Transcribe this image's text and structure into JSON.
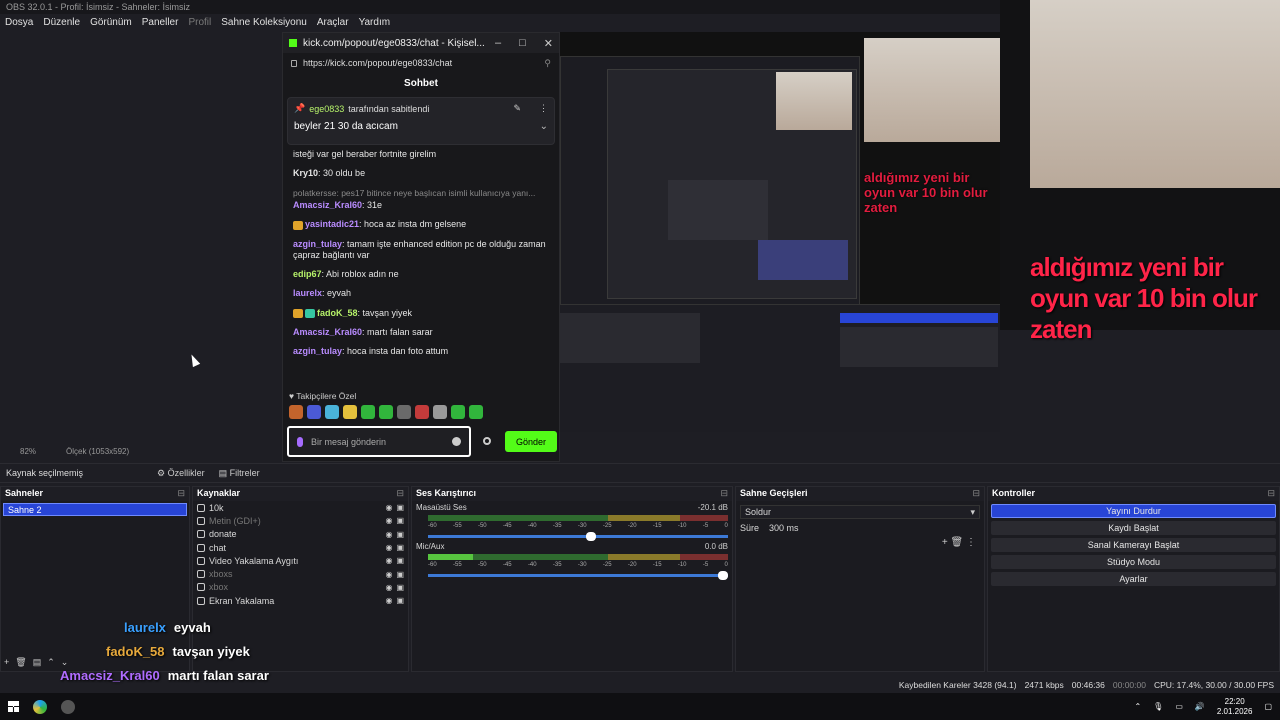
{
  "obs": {
    "title": "OBS 32.0.1 - Profil: İsimsiz - Sahneler: İsimsiz",
    "menu": [
      "Dosya",
      "Düzenle",
      "Görünüm",
      "Paneller",
      "Profil",
      "Sahne Koleksiyonu",
      "Araçlar",
      "Yardım"
    ],
    "zoom": "82%",
    "scale_info": "Ölçek (1053x592)",
    "no_source": "Kaynak seçilmemiş",
    "properties": "Özellikler",
    "filters": "Filtreler"
  },
  "kick": {
    "window_title": "kick.com/popout/ege0833/chat - Kişisel...",
    "url": "https://kick.com/popout/ege0833/chat",
    "chat_title": "Sohbet",
    "pinned_user": "ege0833",
    "pinned_by": "tarafından sabitlendi",
    "pinned_text": "beyler 21 30 da acıcam",
    "messages": [
      {
        "user": "",
        "text": "isteği var gel beraber fortnite girelim",
        "color": "#e6e6e6"
      },
      {
        "user": "Kry10",
        "text": ": 30 oldu be",
        "color": "#e6e6e6"
      },
      {
        "reply": "polatkersse: pes17 bitince neye başlıcan isimli kullanıcıya yanı...",
        "user": "Amacsiz_Kral60",
        "text": ": 31e",
        "color": "#b98cff"
      },
      {
        "user": "yasintadic21",
        "text": ": hoca az insta dm gelsene",
        "color": "#b98cff",
        "badge": true
      },
      {
        "user": "azgin_tulay",
        "text": ": tamam işte enhanced edition pc de olduğu zaman çapraz bağlantı var",
        "color": "#b98cff"
      },
      {
        "user": "edip67",
        "text": ": Abi roblox adın ne",
        "color": "#b6f26a"
      },
      {
        "user": "laurelx",
        "text": ": eyvah",
        "color": "#b98cff"
      },
      {
        "user": "fadoK_58",
        "text": ": tavşan yiyek",
        "color": "#b6f26a",
        "badge": true,
        "badge2": true
      },
      {
        "user": "Amacsiz_Kral60",
        "text": ": martı falan sarar",
        "color": "#b98cff"
      },
      {
        "user": "azgin_tulay",
        "text": ": hoca insta dan foto attum",
        "color": "#b98cff"
      }
    ],
    "followers_label": "Takipçilere Özel",
    "input_placeholder": "Bir mesaj gönderin",
    "send": "Gönder"
  },
  "preview": {
    "caption": "aldığımız yeni bir oyun var 10 bin olur zaten",
    "cam_caption": "aldığımız yeni bir oyun var 10 bin olur zaten"
  },
  "docks": {
    "scenes": {
      "title": "Sahneler",
      "items": [
        "Sahne 2"
      ]
    },
    "sources": {
      "title": "Kaynaklar",
      "items": [
        {
          "name": "10k",
          "dim": false
        },
        {
          "name": "Metin (GDI+)",
          "dim": true
        },
        {
          "name": "donate",
          "dim": false
        },
        {
          "name": "chat",
          "dim": false
        },
        {
          "name": "Video Yakalama Aygıtı",
          "dim": false
        },
        {
          "name": "xboxs",
          "dim": true
        },
        {
          "name": "xbox",
          "dim": true
        },
        {
          "name": "Ekran Yakalama",
          "dim": false
        }
      ]
    },
    "mixer": {
      "title": "Ses Karıştırıcı",
      "tracks": [
        {
          "name": "Masaüstü Ses",
          "db": "-20.1 dB",
          "level": 0.56
        },
        {
          "name": "Mic/Aux",
          "db": "0.0 dB",
          "level": 1.0
        }
      ],
      "ticks": [
        "-60",
        "-55",
        "-50",
        "-45",
        "-40",
        "-35",
        "-30",
        "-25",
        "-20",
        "-15",
        "-10",
        "-5",
        "0"
      ]
    },
    "transitions": {
      "title": "Sahne Geçişleri",
      "selected": "Soldur",
      "duration_label": "Süre",
      "duration": "300 ms"
    },
    "controls": {
      "title": "Kontroller",
      "buttons": [
        "Yayını Durdur",
        "Kaydı Başlat",
        "Sanal Kamerayı Başlat",
        "Stüdyo Modu",
        "Ayarlar"
      ]
    }
  },
  "status": {
    "dropped": "Kaybedilen Kareler 3428 (94.1)",
    "bitrate": "2471 kbps",
    "stream_time": "00:46:36",
    "rec_time": "00:00:00",
    "cpu": "CPU: 17.4%, 30.00 / 30.00 FPS"
  },
  "overlay": [
    {
      "user": "laurelx",
      "text": "eyvah",
      "cls": "n1"
    },
    {
      "user": "fadoK_58",
      "text": "tavşan yiyek",
      "cls": "n2"
    },
    {
      "user": "Amacsiz_Kral60",
      "text": "martı falan sarar",
      "cls": "n3"
    },
    {
      "user": "azgin_tulay",
      "text": "hoca insta dan foto attum",
      "cls": "n3"
    }
  ],
  "taskbar": {
    "time": "22:20",
    "date": "2.01.2026"
  }
}
